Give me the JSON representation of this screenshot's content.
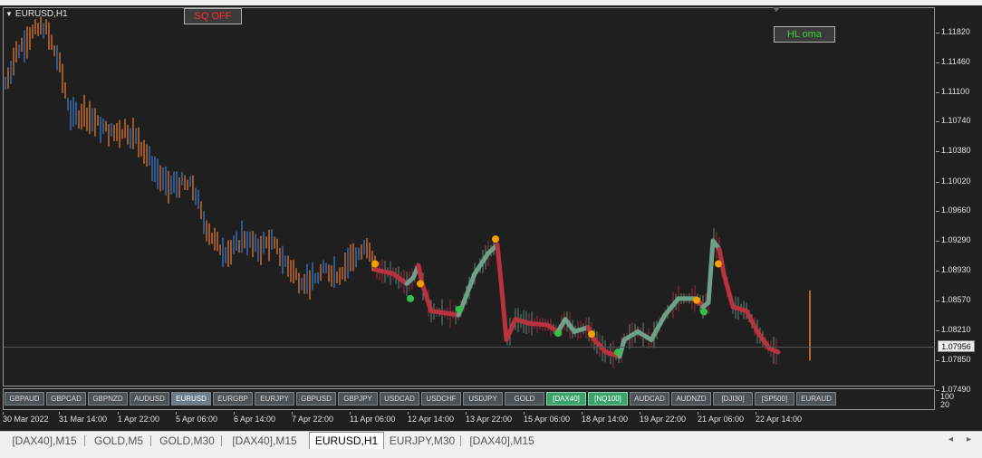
{
  "chart": {
    "symbol_title": "EURUSD,H1",
    "sq_button": "SQ OFF",
    "hl_button": "HL oma",
    "current_price": "1.07956",
    "price_ticks": [
      "1.11820",
      "1.11460",
      "1.11100",
      "1.10740",
      "1.10380",
      "1.10020",
      "1.09660",
      "1.09290",
      "1.08930",
      "1.08570",
      "1.08210",
      "1.07850",
      "1.07490"
    ],
    "time_ticks": [
      "30 Mar 2022",
      "31 Mar 14:00",
      "1 Apr 22:00",
      "5 Apr 06:00",
      "6 Apr 14:00",
      "7 Apr 22:00",
      "11 Apr 06:00",
      "12 Apr 14:00",
      "13 Apr 22:00",
      "15 Apr 06:00",
      "18 Apr 14:00",
      "19 Apr 22:00",
      "21 Apr 06:00",
      "22 Apr 14:00"
    ],
    "indicator_axis": [
      "100",
      "20"
    ],
    "symbol_buttons": [
      "GBPAUD",
      "GBPCAD",
      "GBPNZD",
      "AUDUSD",
      "EURUSD",
      "EURGBP",
      "EURJPY",
      "GBPUSD",
      "GBPJPY",
      "USDCAD",
      "USDCHF",
      "USDJPY",
      "GOLD",
      "[DAX40]",
      "[NQ100]",
      "AUDCAD",
      "AUDNZD",
      "[DJI30]",
      "[SP500]",
      "EURAUD"
    ],
    "active_symbol": "EURUSD",
    "green_symbols": [
      "[DAX40]",
      "[NQ100]"
    ]
  },
  "tabs": [
    "[DAX40],M15",
    "GOLD,M5",
    "GOLD,M30",
    "[DAX40],M15",
    "EURUSD,H1",
    "EURJPY,M30",
    "[DAX40],M15"
  ],
  "active_tab": "EURUSD,H1",
  "colors": {
    "background": "#1f1f1f",
    "bull_candle": "#3f7fd6",
    "bear_candle": "#f07f2f",
    "oma_up": "#6fa08a",
    "oma_down": "#b8323f",
    "signal_green": "#33c24a",
    "signal_orange": "#f5a000"
  }
}
